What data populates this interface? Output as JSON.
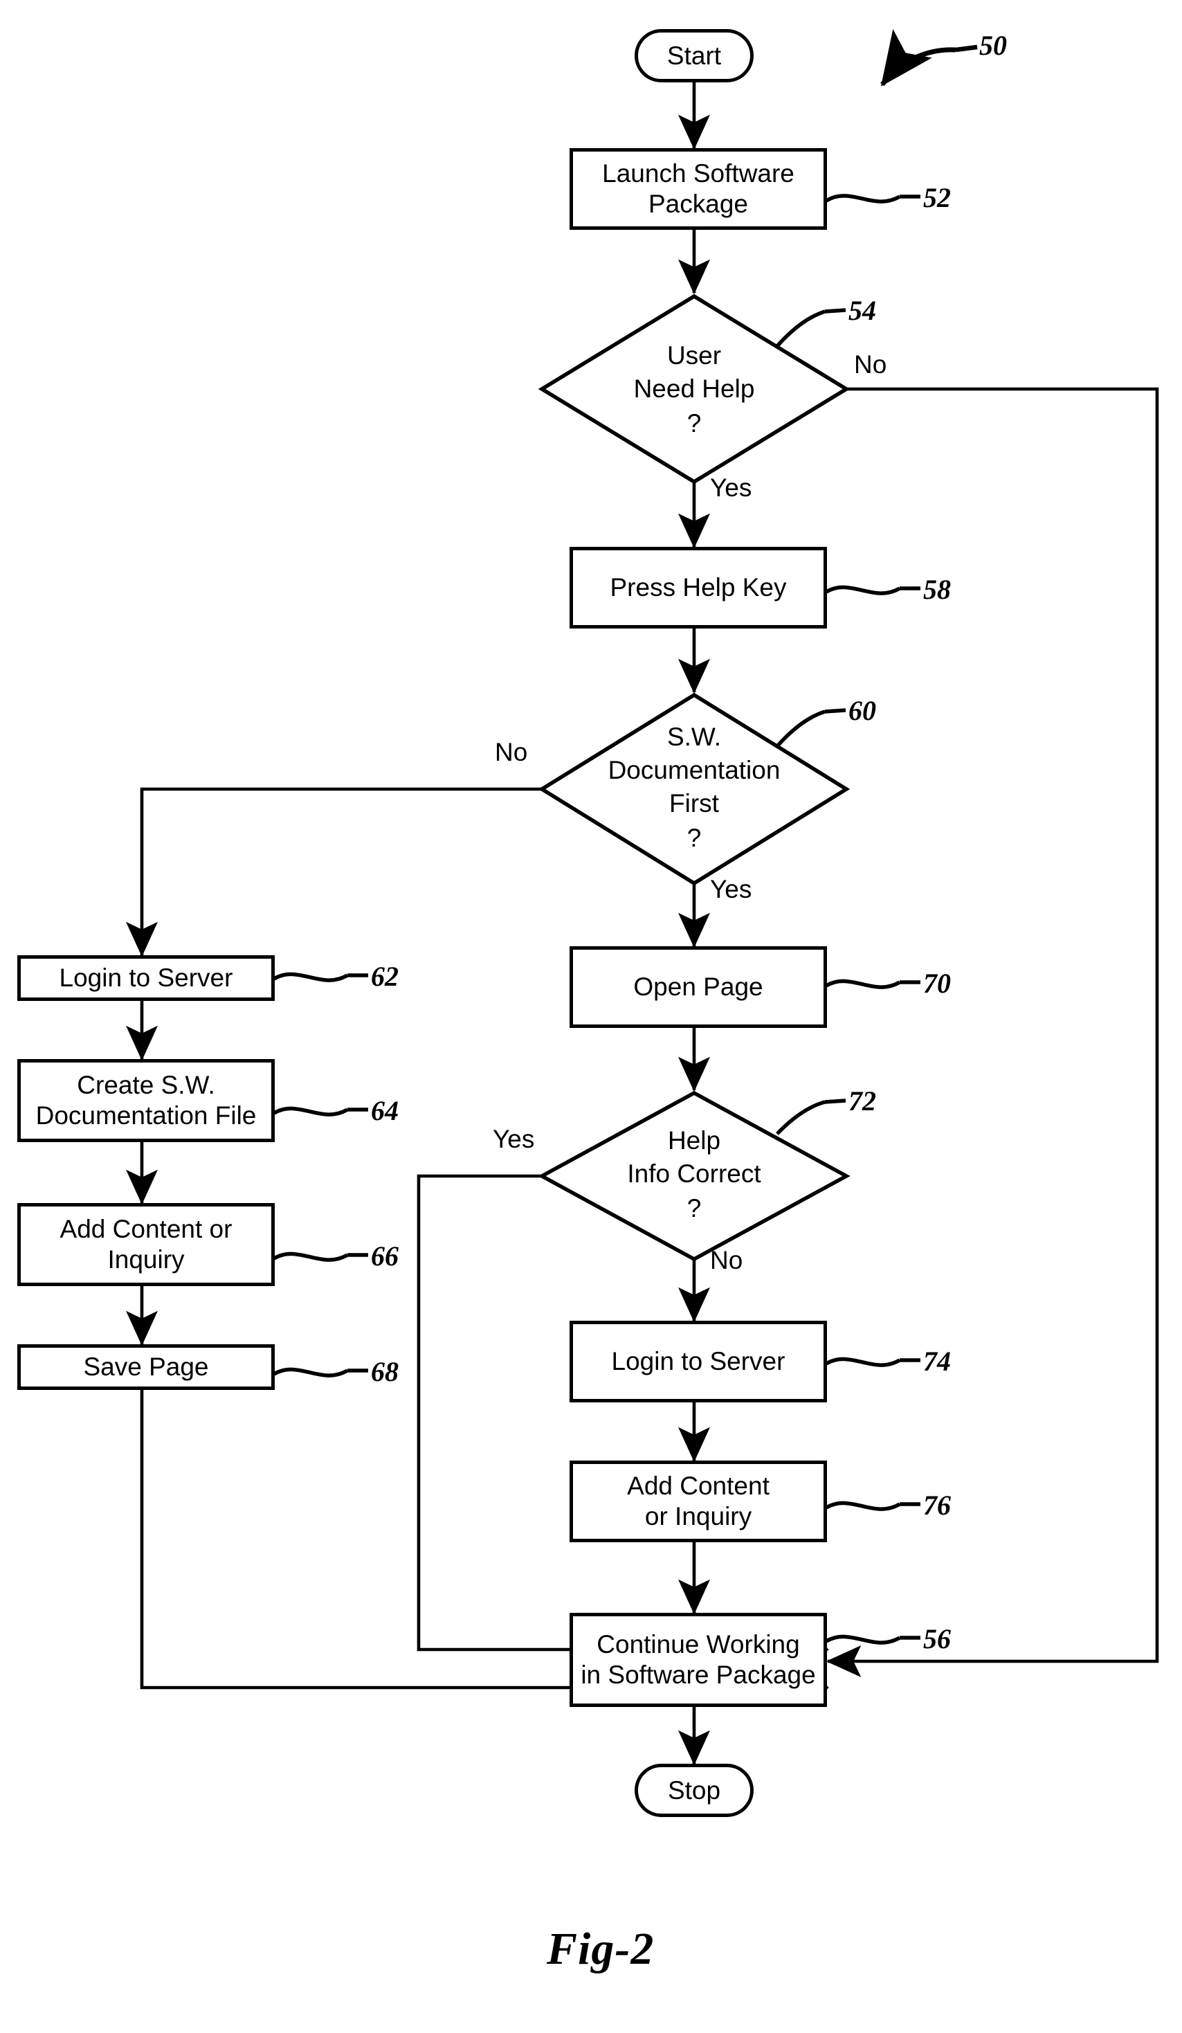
{
  "figure": {
    "caption": "Fig-2",
    "diagram_ref": "50"
  },
  "nodes": {
    "start": {
      "label": "Start",
      "ref": ""
    },
    "launch": {
      "label": "Launch Software\nPackage",
      "line1": "Launch Software",
      "line2": "Package",
      "ref": "52"
    },
    "need_help": {
      "line1": "User",
      "line2": "Need Help",
      "q": "?",
      "ref": "54"
    },
    "press_help": {
      "label": "Press Help Key",
      "ref": "58"
    },
    "doc_first": {
      "line1": "S.W.",
      "line2": "Documentation",
      "line3": "First",
      "q": "?",
      "ref": "60"
    },
    "login_left": {
      "label": "Login to Server",
      "ref": "62"
    },
    "create_file": {
      "line1": "Create S.W.",
      "line2": "Documentation File",
      "ref": "64"
    },
    "add_content_left": {
      "line1": "Add Content or",
      "line2": "Inquiry",
      "ref": "66"
    },
    "save_page": {
      "label": "Save Page",
      "ref": "68"
    },
    "open_page": {
      "label": "Open Page",
      "ref": "70"
    },
    "info_correct": {
      "line1": "Help",
      "line2": "Info Correct",
      "q": "?",
      "ref": "72"
    },
    "login_center": {
      "label": "Login to Server",
      "ref": "74"
    },
    "add_content_center": {
      "line1": "Add Content",
      "line2": "or Inquiry",
      "ref": "76"
    },
    "continue_working": {
      "line1": "Continue Working",
      "line2": "in Software Package",
      "ref": "56"
    },
    "stop": {
      "label": "Stop",
      "ref": ""
    }
  },
  "edge_labels": {
    "need_help_no": "No",
    "need_help_yes": "Yes",
    "doc_first_no": "No",
    "doc_first_yes": "Yes",
    "info_correct_yes": "Yes",
    "info_correct_no": "No"
  },
  "chart_data": {
    "type": "flowchart",
    "title": "Fig-2",
    "diagram_ref": "50",
    "steps": [
      {
        "ref": "",
        "id": "start",
        "shape": "terminator",
        "text": "Start"
      },
      {
        "ref": "52",
        "id": "launch",
        "shape": "process",
        "text": "Launch Software Package"
      },
      {
        "ref": "54",
        "id": "need_help",
        "shape": "decision",
        "text": "User Need Help ?"
      },
      {
        "ref": "58",
        "id": "press_help",
        "shape": "process",
        "text": "Press Help Key"
      },
      {
        "ref": "60",
        "id": "doc_first",
        "shape": "decision",
        "text": "S.W. Documentation First ?"
      },
      {
        "ref": "62",
        "id": "login_left",
        "shape": "process",
        "text": "Login to Server"
      },
      {
        "ref": "64",
        "id": "create_file",
        "shape": "process",
        "text": "Create S.W. Documentation File"
      },
      {
        "ref": "66",
        "id": "add_content_left",
        "shape": "process",
        "text": "Add Content or Inquiry"
      },
      {
        "ref": "68",
        "id": "save_page",
        "shape": "process",
        "text": "Save Page"
      },
      {
        "ref": "70",
        "id": "open_page",
        "shape": "process",
        "text": "Open Page"
      },
      {
        "ref": "72",
        "id": "info_correct",
        "shape": "decision",
        "text": "Help Info Correct ?"
      },
      {
        "ref": "74",
        "id": "login_center",
        "shape": "process",
        "text": "Login to Server"
      },
      {
        "ref": "76",
        "id": "add_content_center",
        "shape": "process",
        "text": "Add Content or Inquiry"
      },
      {
        "ref": "56",
        "id": "continue_working",
        "shape": "process",
        "text": "Continue Working in Software Package"
      },
      {
        "ref": "",
        "id": "stop",
        "shape": "terminator",
        "text": "Stop"
      }
    ],
    "edges": [
      {
        "from": "start",
        "to": "launch",
        "label": ""
      },
      {
        "from": "launch",
        "to": "need_help",
        "label": ""
      },
      {
        "from": "need_help",
        "to": "continue_working",
        "label": "No"
      },
      {
        "from": "need_help",
        "to": "press_help",
        "label": "Yes"
      },
      {
        "from": "press_help",
        "to": "doc_first",
        "label": ""
      },
      {
        "from": "doc_first",
        "to": "login_left",
        "label": "No"
      },
      {
        "from": "doc_first",
        "to": "open_page",
        "label": "Yes"
      },
      {
        "from": "login_left",
        "to": "create_file",
        "label": ""
      },
      {
        "from": "create_file",
        "to": "add_content_left",
        "label": ""
      },
      {
        "from": "add_content_left",
        "to": "save_page",
        "label": ""
      },
      {
        "from": "save_page",
        "to": "continue_working",
        "label": ""
      },
      {
        "from": "open_page",
        "to": "info_correct",
        "label": ""
      },
      {
        "from": "info_correct",
        "to": "continue_working",
        "label": "Yes"
      },
      {
        "from": "info_correct",
        "to": "login_center",
        "label": "No"
      },
      {
        "from": "login_center",
        "to": "add_content_center",
        "label": ""
      },
      {
        "from": "add_content_center",
        "to": "continue_working",
        "label": ""
      },
      {
        "from": "continue_working",
        "to": "stop",
        "label": ""
      }
    ]
  }
}
